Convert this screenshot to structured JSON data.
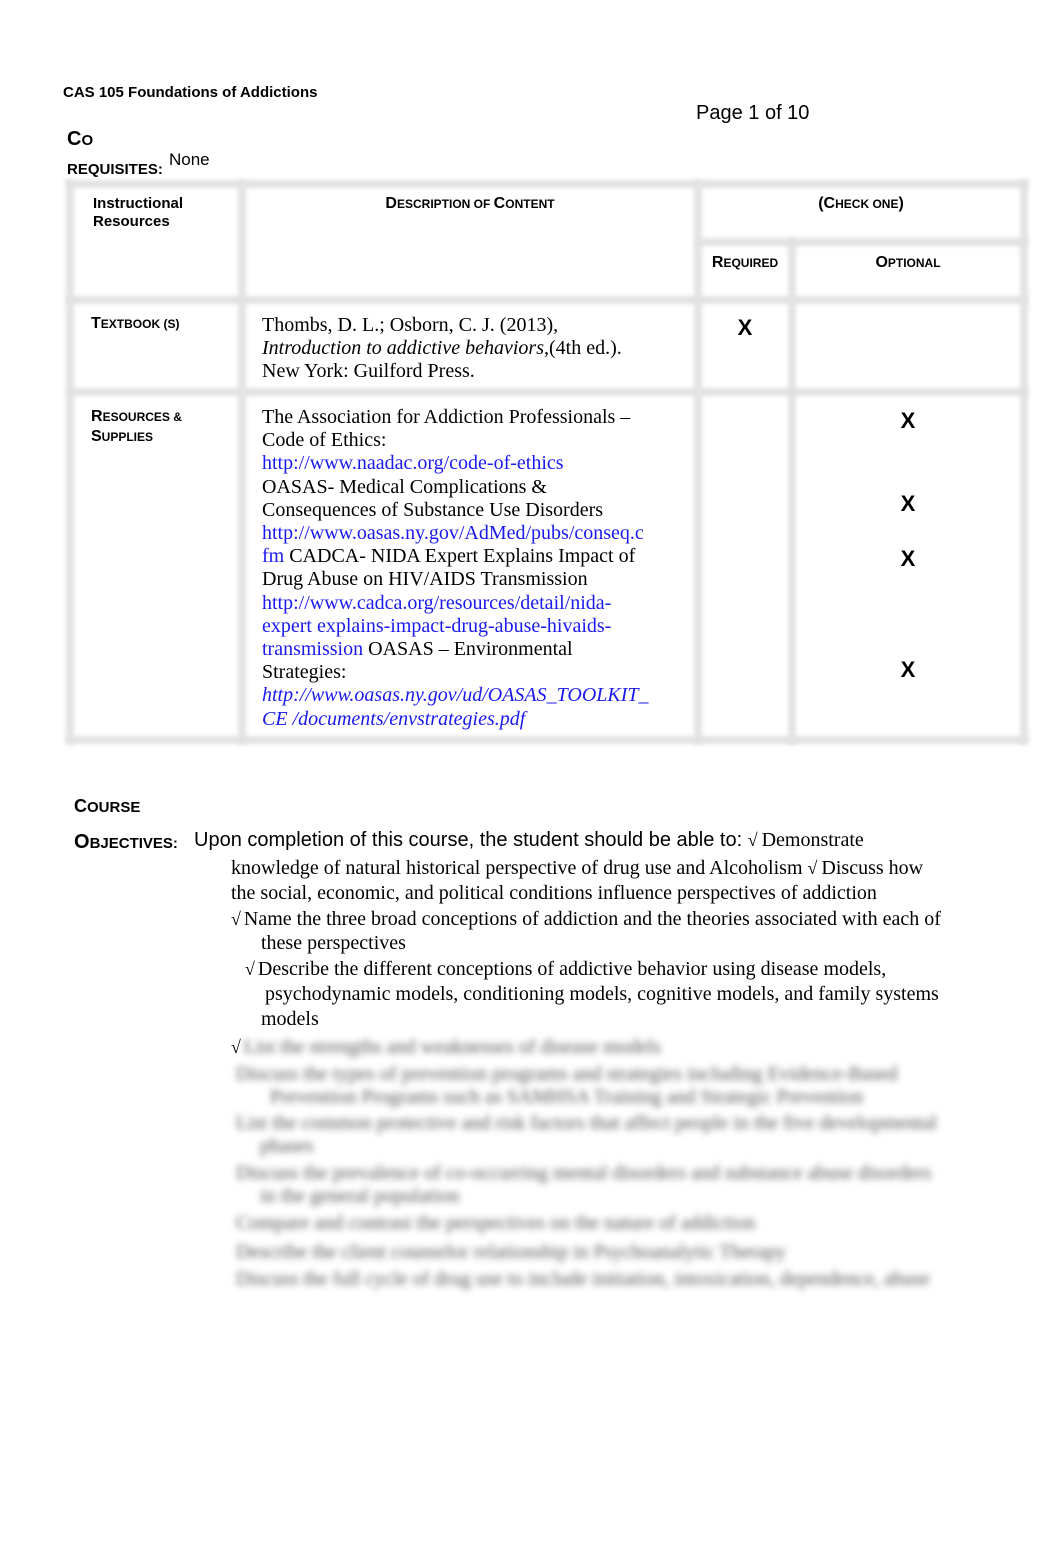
{
  "header": {
    "course_title": "CAS 105 Foundations of Addictions",
    "page_indicator": "Page 1 of 10"
  },
  "corequisites": {
    "label_line1_big": "C",
    "label_line1_small": "O",
    "label_line2": "REQUISITES:",
    "value": "None"
  },
  "table": {
    "headers": {
      "col1_line1": "Instructional",
      "col1_line2": "Resources",
      "col2_d": "D",
      "col2_rest1": "ESCRIPTION OF ",
      "col2_c": "C",
      "col2_rest2": "ONTENT",
      "group_open": "(",
      "group_c": "C",
      "group_rest": "HECK ONE",
      "group_close": ")",
      "required_r": "R",
      "required_rest": "EQUIRED",
      "optional_o": "O",
      "optional_rest": "PTIONAL"
    },
    "rows": [
      {
        "label_big": "T",
        "label_rest": "EXTBOOK (S)",
        "lines": [
          "Thombs, D. L.; Osborn, C. J. (2013),",
          "Introduction  to addictive behaviors",
          ",(4th ed.).",
          "New York:  Guilford Press."
        ],
        "required_mark": "X"
      },
      {
        "label_line1_big": "R",
        "label_line1_rest": "ESOURCES &",
        "label_line2_big": "S",
        "label_line2_rest": "UPPLIES",
        "items": {
          "naadac_title_1": "The Association for Addiction Professionals –",
          "naadac_title_2": "Code  of Ethics:",
          "naadac_url": "http://www.naadac.org/code-of-ethics",
          "oasas_title_1": "OASAS- Medical Complications &",
          "oasas_title_2": "Consequences  of Substance Use Disorders",
          "oasas_url_1": "http://www.oasas.ny.gov/AdMed/pubs/conseq.c",
          "oasas_url_2": "fm",
          "cadca_title_1": " CADCA- NIDA Expert Explains Impact of",
          "cadca_title_2": "Drug  Abuse on HIV/AIDS Transmission",
          "cadca_url_1": "http://www.cadca.org/resources/detail/nida-",
          "cadca_url_2": "expert explains-impact-drug-abuse-hivaids-",
          "cadca_url_3": "transmission",
          "env_title_1": " OASAS – Environmental",
          "env_title_2": "Strategies:",
          "env_url_1": "http://www.oasas.ny.gov/ud/OASAS_TOOLKIT_",
          "env_url_2": "CE /documents/envstrategies.pdf"
        },
        "optional_marks": [
          "X",
          "X",
          "X",
          "X"
        ]
      }
    ]
  },
  "objectives": {
    "course_big": "C",
    "course_rest": "OURSE",
    "label_big": "O",
    "label_rest": "BJECTIVES:",
    "intro": "Upon completion of this course, the student should be able to: ",
    "check_glyph": "√",
    "lines": [
      "Demonstrate",
      "knowledge of natural historical perspective of drug use and Alcoholism ",
      "Discuss how",
      "the social, economic, and political conditions influence perspectives of  addiction",
      "Name the three broad conceptions of addiction and the theories associated with each of",
      "these perspectives",
      "Describe the different conceptions of addictive behavior using disease models,",
      "psychodynamic models, conditioning models, cognitive models, and family systems",
      "models"
    ],
    "blurred_lines": [
      "List the strengths and weaknesses of disease models",
      "Discuss the types of prevention programs and strategies including Evidence-Based",
      "Prevention Programs such as SAMHSA Training and Strategic Prevention",
      "List the common protective and risk factors that affect people in the five developmental",
      "phases",
      "Discuss the prevalence of co-occurring mental disorders and substance abuse disorders",
      "in the general population",
      "Compare and contrast the perspectives on the nature of addiction",
      "Describe the client counselor relationship in Psychoanalytic Therapy",
      "Discuss the full cycle of drug use to include initiation, intoxication, dependence, abuse"
    ]
  }
}
